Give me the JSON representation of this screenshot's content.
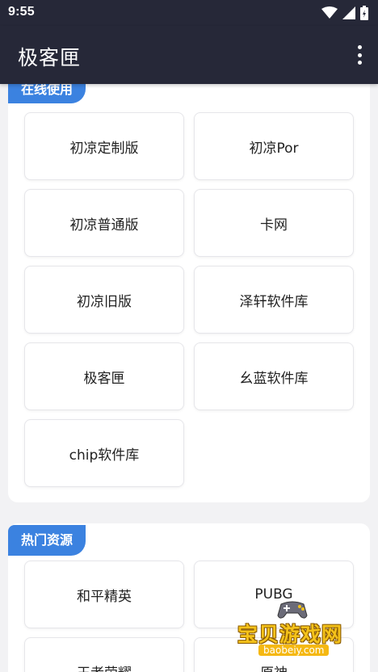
{
  "status": {
    "time": "9:55"
  },
  "app": {
    "title": "极客匣"
  },
  "online": {
    "tag": "在线使用",
    "items": [
      "初凉定制版",
      "初凉Por",
      "初凉普通版",
      "卡网",
      "初凉旧版",
      "泽轩软件库",
      "极客匣",
      "幺蓝软件库",
      "chip软件库"
    ]
  },
  "hot": {
    "tag": "热门资源",
    "items": [
      "和平精英",
      "PUBG",
      "王者荣耀",
      "原神"
    ]
  },
  "watermark": {
    "text": "宝贝游戏网",
    "url": "baobeiy.com"
  },
  "icons": {
    "wifi": "wifi-icon",
    "signal": "cell-signal-icon",
    "battery": "battery-icon",
    "menu": "more-vert-icon"
  },
  "colors": {
    "appbar": "#262838",
    "accent": "#3b82e0",
    "background": "#f2f2f4"
  }
}
